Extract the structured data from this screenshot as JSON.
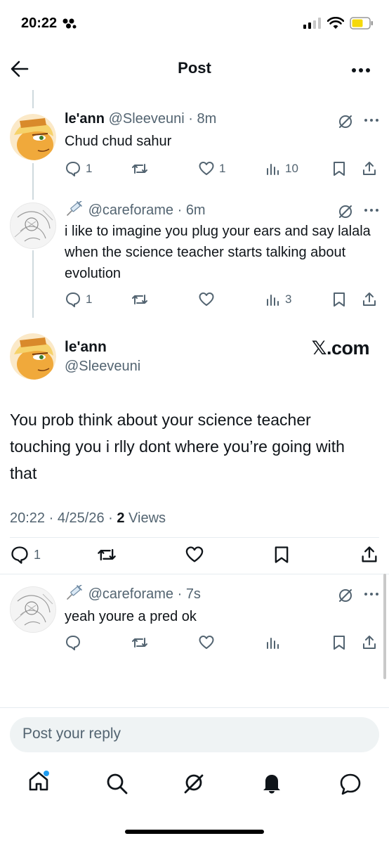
{
  "status_bar": {
    "time": "20:22"
  },
  "header": {
    "title": "Post"
  },
  "replies_above": [
    {
      "name": "le'ann",
      "handle": "@Sleeveuni",
      "time": "8m",
      "text": "Chud chud sahur",
      "reply_count": "1",
      "like_count": "1",
      "view_count": "10"
    },
    {
      "name": "",
      "handle": "@careforame",
      "time": "6m",
      "text": "i like to imagine you plug your ears and say lalala when the science teacher starts talking about evolution",
      "reply_count": "1",
      "view_count": "3"
    }
  ],
  "main_post": {
    "name": "le'ann",
    "handle": "@Sleeveuni",
    "watermark": "𝕏.com",
    "text": "You prob think about your science teacher touching you i rlly dont where you’re going with that",
    "time": "20:22",
    "date": "4/25/26",
    "views": "2",
    "views_label": "Views",
    "reply_count": "1"
  },
  "reply_below": {
    "handle": "@careforame",
    "time": "7s",
    "text": "yeah youre a pred ok"
  },
  "reply_bar": {
    "placeholder": "Post your reply"
  },
  "colors": {
    "accent": "#1d9bf0",
    "muted": "#536471",
    "text": "#0f1419",
    "battery": "#f5d90a",
    "avatar_bg": "#f0a93b"
  }
}
